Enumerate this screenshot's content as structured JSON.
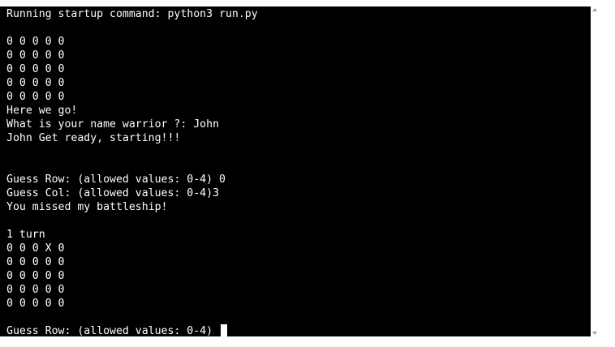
{
  "terminal": {
    "lines": [
      "Running startup command: python3 run.py",
      "",
      "0 0 0 0 0",
      "0 0 0 0 0",
      "0 0 0 0 0",
      "0 0 0 0 0",
      "0 0 0 0 0",
      "Here we go!",
      "What is your name warrior ?: John",
      "John Get ready, starting!!!",
      "",
      "",
      "Guess Row: (allowed values: 0-4) 0",
      "Guess Col: (allowed values: 0-4)3",
      "You missed my battleship!",
      "",
      "1 turn",
      "0 0 0 X 0",
      "0 0 0 0 0",
      "0 0 0 0 0",
      "0 0 0 0 0",
      "0 0 0 0 0",
      "",
      "Guess Row: (allowed values: 0-4) "
    ]
  },
  "colors": {
    "background": "#000000",
    "foreground": "#ffffff"
  }
}
